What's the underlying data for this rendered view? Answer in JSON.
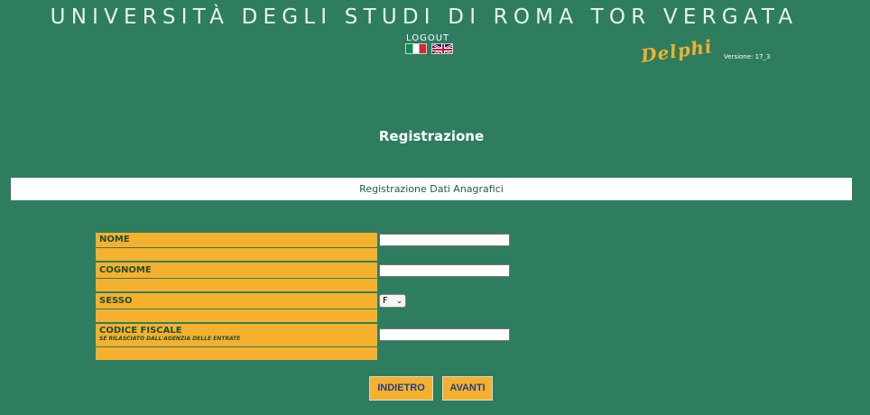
{
  "header": {
    "title": "UNIVERSITÀ DEGLI STUDI DI ROMA TOR VERGATA",
    "logout_label": "LOGOUT",
    "app_name": "Delphi",
    "version": "Versione: 17_3"
  },
  "page": {
    "heading": "Registrazione",
    "section_title": "Registrazione Dati Anagrafici"
  },
  "form": {
    "nome_label": "NOME",
    "nome_value": "",
    "cognome_label": "COGNOME",
    "cognome_value": "",
    "sesso_label": "SESSO",
    "sesso_value": "F",
    "codice_fiscale_label": "CODICE FISCALE",
    "codice_fiscale_sublabel": "SE RILASCIATO DALL'AGENZIA DELLE ENTRATE",
    "codice_fiscale_value": ""
  },
  "buttons": {
    "back_label": "INDIETRO",
    "next_label": "AVANTI"
  },
  "colors": {
    "background": "#2e7d5e",
    "label_bg": "#f5b12e",
    "brand_accent": "#f0b030"
  },
  "icons": {
    "lang_it": "italian-flag-icon",
    "lang_en": "uk-flag-icon"
  }
}
